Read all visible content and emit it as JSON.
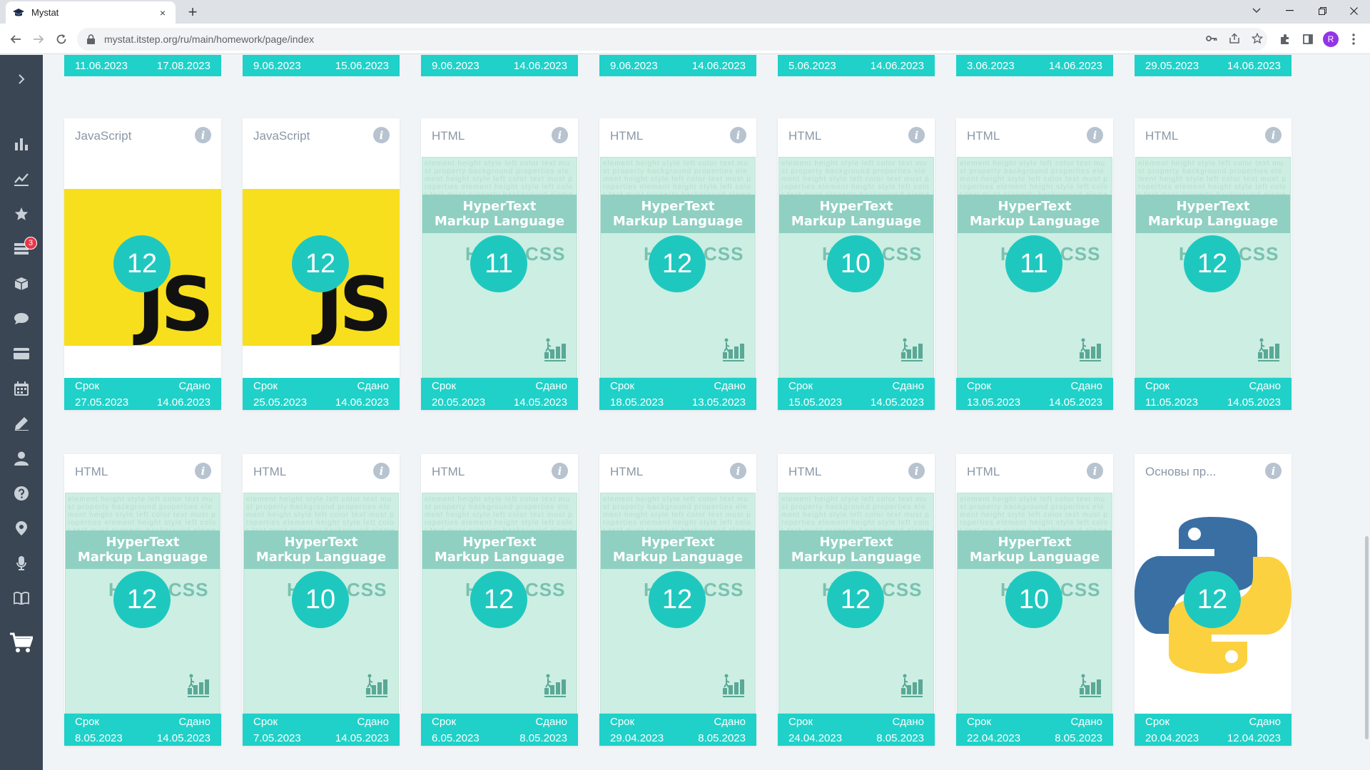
{
  "browser": {
    "tab_title": "Mystat",
    "new_tab": "+",
    "close_tab": "×",
    "url": "mystat.itstep.org/ru/main/homework/page/index",
    "profile_initial": "R"
  },
  "sidebar": {
    "toggle": "›",
    "items": [
      {
        "name": "stats-icon"
      },
      {
        "name": "chart-line-icon"
      },
      {
        "name": "star-icon"
      },
      {
        "name": "homework-icon",
        "badge": "3"
      },
      {
        "name": "library-icon"
      },
      {
        "name": "chat-icon"
      },
      {
        "name": "wallet-icon"
      },
      {
        "name": "calendar-icon"
      },
      {
        "name": "pen-icon"
      },
      {
        "name": "profile-icon"
      },
      {
        "name": "help-icon"
      },
      {
        "name": "location-icon"
      },
      {
        "name": "microphone-icon"
      },
      {
        "name": "book-icon"
      },
      {
        "name": "cart-icon"
      }
    ]
  },
  "labels": {
    "due": "Срок",
    "done": "Сдано",
    "info": "i"
  },
  "top_row": [
    {
      "due": "11.06.2023",
      "done": "17.08.2023"
    },
    {
      "due": "9.06.2023",
      "done": "15.06.2023"
    },
    {
      "due": "9.06.2023",
      "done": "14.06.2023"
    },
    {
      "due": "9.06.2023",
      "done": "14.06.2023"
    },
    {
      "due": "5.06.2023",
      "done": "14.06.2023"
    },
    {
      "due": "3.06.2023",
      "done": "14.06.2023"
    },
    {
      "due": "29.05.2023",
      "done": "14.06.2023"
    }
  ],
  "cover_text": {
    "line1": "HyperText",
    "line2": "Markup Language",
    "css": "HTML CSS",
    "js": "JS",
    "words": "element height style left color text must property background properties element height style left color text must properties element height style left color text must property background element height style left color text must"
  },
  "rows": [
    [
      {
        "subject": "JavaScript",
        "cover": "js",
        "grade": "12",
        "due": "27.05.2023",
        "done": "14.06.2023"
      },
      {
        "subject": "JavaScript",
        "cover": "js",
        "grade": "12",
        "due": "25.05.2023",
        "done": "14.06.2023"
      },
      {
        "subject": "HTML",
        "cover": "html",
        "grade": "11",
        "due": "20.05.2023",
        "done": "14.05.2023"
      },
      {
        "subject": "HTML",
        "cover": "html",
        "grade": "12",
        "due": "18.05.2023",
        "done": "13.05.2023"
      },
      {
        "subject": "HTML",
        "cover": "html",
        "grade": "10",
        "due": "15.05.2023",
        "done": "14.05.2023"
      },
      {
        "subject": "HTML",
        "cover": "html",
        "grade": "11",
        "due": "13.05.2023",
        "done": "14.05.2023"
      },
      {
        "subject": "HTML",
        "cover": "html",
        "grade": "12",
        "due": "11.05.2023",
        "done": "14.05.2023"
      }
    ],
    [
      {
        "subject": "HTML",
        "cover": "html",
        "grade": "12",
        "due": "8.05.2023",
        "done": "14.05.2023"
      },
      {
        "subject": "HTML",
        "cover": "html",
        "grade": "10",
        "due": "7.05.2023",
        "done": "14.05.2023"
      },
      {
        "subject": "HTML",
        "cover": "html",
        "grade": "12",
        "due": "6.05.2023",
        "done": "8.05.2023"
      },
      {
        "subject": "HTML",
        "cover": "html",
        "grade": "12",
        "due": "29.04.2023",
        "done": "8.05.2023"
      },
      {
        "subject": "HTML",
        "cover": "html",
        "grade": "12",
        "due": "24.04.2023",
        "done": "8.05.2023"
      },
      {
        "subject": "HTML",
        "cover": "html",
        "grade": "10",
        "due": "22.04.2023",
        "done": "8.05.2023"
      },
      {
        "subject": "Основы пр...",
        "cover": "python",
        "grade": "12",
        "due": "20.04.2023",
        "done": "12.04.2023"
      }
    ]
  ],
  "colors": {
    "accent": "#1fd1c8",
    "grade_circle": "#1fc8bf",
    "sidebar": "#3b4654",
    "badge": "#e8374a"
  }
}
